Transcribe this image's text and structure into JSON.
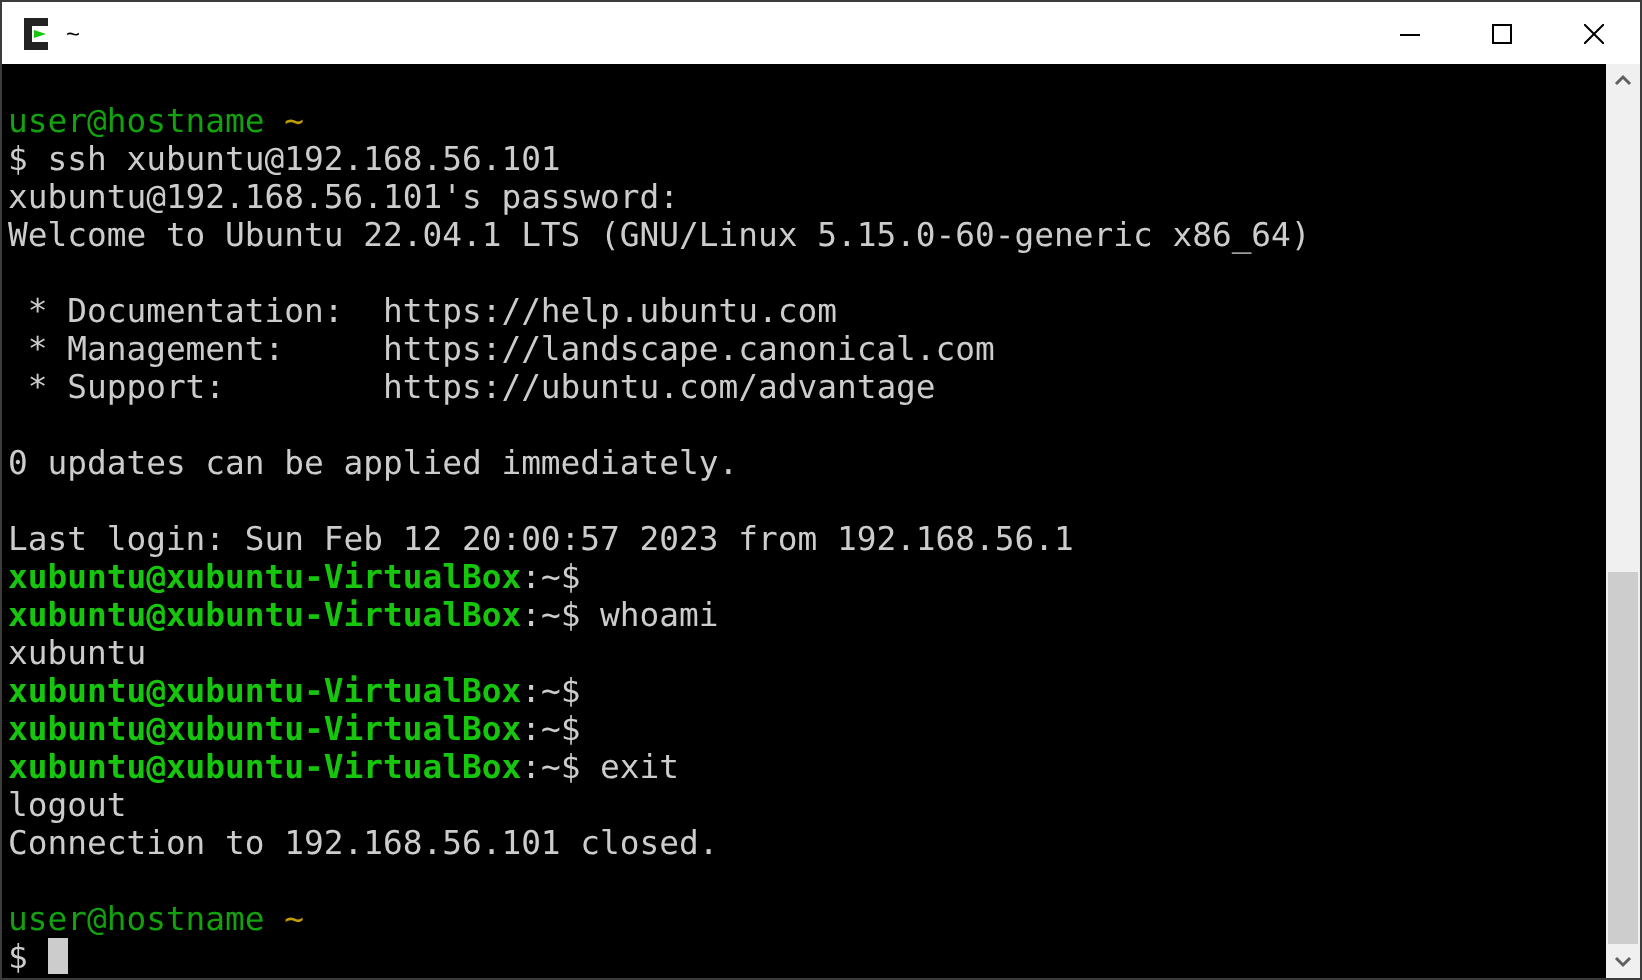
{
  "window": {
    "title": "~"
  },
  "terminal": {
    "blocks": [
      {
        "lines": [
          {
            "segments": [
              {
                "text": "user@hostname",
                "kind": "local-user"
              },
              {
                "text": " ~",
                "kind": "path"
              }
            ]
          },
          {
            "segments": [
              {
                "text": "$ ssh xubuntu@192.168.56.101",
                "kind": "plain"
              }
            ]
          },
          {
            "segments": [
              {
                "text": "xubuntu@192.168.56.101's password:",
                "kind": "plain"
              }
            ]
          },
          {
            "segments": [
              {
                "text": "Welcome to Ubuntu 22.04.1 LTS (GNU/Linux 5.15.0-60-generic x86_64)",
                "kind": "plain"
              }
            ]
          }
        ]
      },
      {
        "lines": [
          {
            "segments": [
              {
                "text": " * Documentation:  https://help.ubuntu.com",
                "kind": "plain"
              }
            ]
          },
          {
            "segments": [
              {
                "text": " * Management:     https://landscape.canonical.com",
                "kind": "plain"
              }
            ]
          },
          {
            "segments": [
              {
                "text": " * Support:        https://ubuntu.com/advantage",
                "kind": "plain"
              }
            ]
          }
        ]
      },
      {
        "lines": [
          {
            "segments": [
              {
                "text": "0 updates can be applied immediately.",
                "kind": "plain"
              }
            ]
          }
        ]
      },
      {
        "lines": [
          {
            "segments": [
              {
                "text": "Last login: Sun Feb 12 20:00:57 2023 from 192.168.56.1",
                "kind": "plain"
              }
            ]
          },
          {
            "segments": [
              {
                "text": "xubuntu@xubuntu-VirtualBox",
                "kind": "remote-user"
              },
              {
                "text": ":~$",
                "kind": "plain"
              }
            ]
          },
          {
            "segments": [
              {
                "text": "xubuntu@xubuntu-VirtualBox",
                "kind": "remote-user"
              },
              {
                "text": ":~$ whoami",
                "kind": "plain"
              }
            ]
          },
          {
            "segments": [
              {
                "text": "xubuntu",
                "kind": "plain"
              }
            ]
          },
          {
            "segments": [
              {
                "text": "xubuntu@xubuntu-VirtualBox",
                "kind": "remote-user"
              },
              {
                "text": ":~$",
                "kind": "plain"
              }
            ]
          },
          {
            "segments": [
              {
                "text": "xubuntu@xubuntu-VirtualBox",
                "kind": "remote-user"
              },
              {
                "text": ":~$",
                "kind": "plain"
              }
            ]
          },
          {
            "segments": [
              {
                "text": "xubuntu@xubuntu-VirtualBox",
                "kind": "remote-user"
              },
              {
                "text": ":~$ exit",
                "kind": "plain"
              }
            ]
          },
          {
            "segments": [
              {
                "text": "logout",
                "kind": "plain"
              }
            ]
          },
          {
            "segments": [
              {
                "text": "Connection to 192.168.56.101 closed.",
                "kind": "plain"
              }
            ]
          }
        ]
      },
      {
        "lines": [
          {
            "segments": [
              {
                "text": "user@hostname",
                "kind": "local-user"
              },
              {
                "text": " ~",
                "kind": "path"
              }
            ]
          },
          {
            "segments": [
              {
                "text": "$ ",
                "kind": "plain"
              }
            ],
            "cursor": true
          }
        ]
      }
    ]
  }
}
